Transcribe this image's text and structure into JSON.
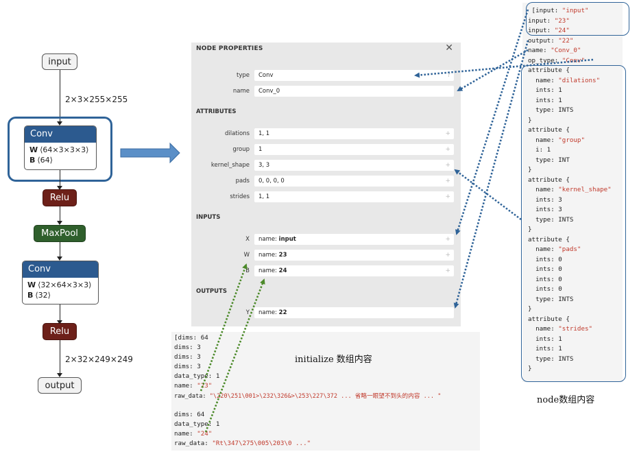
{
  "graph": {
    "input_label": "input",
    "dim_top": "2×3×255×255",
    "conv1": {
      "title": "Conv",
      "w_key": "W",
      "w_val": "⟨64×3×3×3⟩",
      "b_key": "B",
      "b_val": "⟨64⟩"
    },
    "relu1": "Relu",
    "maxpool": "MaxPool",
    "conv2": {
      "title": "Conv",
      "w_key": "W",
      "w_val": "⟨32×64×3×3⟩",
      "b_key": "B",
      "b_val": "⟨32⟩"
    },
    "relu2": "Relu",
    "dim_bottom": "2×32×249×249",
    "output_label": "output"
  },
  "panel": {
    "title": "NODE PROPERTIES",
    "close": "✕",
    "type_label": "type",
    "type_value": "Conv",
    "name_label": "name",
    "name_value": "Conv_0",
    "attributes_header": "ATTRIBUTES",
    "attributes": [
      {
        "label": "dilations",
        "value": "1, 1"
      },
      {
        "label": "group",
        "value": "1"
      },
      {
        "label": "kernel_shape",
        "value": "3, 3"
      },
      {
        "label": "pads",
        "value": "0, 0, 0, 0"
      },
      {
        "label": "strides",
        "value": "1, 1"
      }
    ],
    "inputs_header": "INPUTS",
    "inputs": [
      {
        "label": "X",
        "prefix": "name: ",
        "value": "input"
      },
      {
        "label": "W",
        "prefix": "name: ",
        "value": "23"
      },
      {
        "label": "B",
        "prefix": "name: ",
        "value": "24"
      }
    ],
    "outputs_header": "OUTPUTS",
    "outputs": [
      {
        "label": "Y",
        "prefix": "name: ",
        "value": "22"
      }
    ],
    "plus": "+"
  },
  "init_code": {
    "caption": "initialize 数组内容",
    "lines": [
      "[dims: 64",
      "dims: 3",
      "dims: 3",
      "dims: 3",
      "data_type: 1",
      "name: \"23\"",
      "raw_data: \"\\220\\251\\001>\\232\\326&>\\253\\227\\372 ... 省略一眼望不到头的内容 ... \"",
      "",
      "dims: 64",
      "data_type: 1",
      "name: \"24\"",
      "raw_data: \"Rt\\347\\275\\005\\203\\0 ...\""
    ]
  },
  "node_code": {
    "caption": "node数组内容",
    "lines": [
      " [input: \"input\"",
      "input: \"23\"",
      "input: \"24\"",
      "output: \"22\"",
      "name: \"Conv_0\"",
      "op_type: \"Conv\"",
      "attribute {",
      "  name: \"dilations\"",
      "  ints: 1",
      "  ints: 1",
      "  type: INTS",
      "}",
      "attribute {",
      "  name: \"group\"",
      "  i: 1",
      "  type: INT",
      "}",
      "attribute {",
      "  name: \"kernel_shape\"",
      "  ints: 3",
      "  ints: 3",
      "  type: INTS",
      "}",
      "attribute {",
      "  name: \"pads\"",
      "  ints: 0",
      "  ints: 0",
      "  ints: 0",
      "  ints: 0",
      "  type: INTS",
      "}",
      "attribute {",
      "  name: \"strides\"",
      "  ints: 1",
      "  ints: 1",
      "  type: INTS",
      "}"
    ]
  },
  "colors": {
    "conv_header": "#2c5a8f",
    "relu": "#6d2019",
    "maxpool": "#2f5f2c",
    "highlight": "#2f6398",
    "arrow_blue": "#2f6398",
    "arrow_green": "#4c8a2a",
    "string_red": "#c0392b"
  }
}
